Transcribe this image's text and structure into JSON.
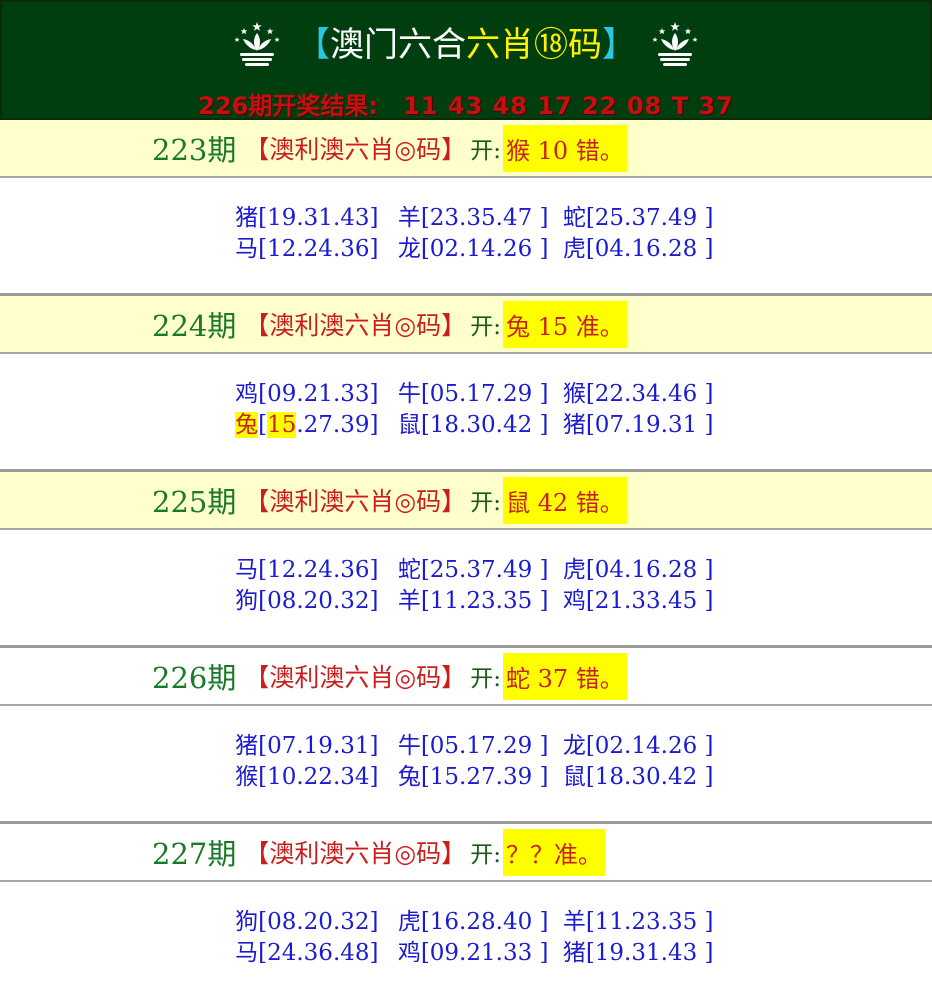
{
  "header": {
    "bracket_left": "【",
    "title_part1": "澳门六合",
    "title_part2": "六肖⑱码",
    "bracket_right": "】",
    "result_label": "226期开奖结果:",
    "result_numbers": "11 43 48 17 22 08 T 37"
  },
  "colors": {
    "header_bg": "#003e10",
    "title_bracket": "#26c9e0",
    "title_highlight": "#fff200",
    "result_red": "#c41010",
    "issue_green": "#1a7a2a",
    "label_red": "#c81e1e",
    "zodiac_blue": "#1b1bd0",
    "answer_bg": "#ffff00",
    "cream_bg": "#ffffcc"
  },
  "periods": [
    {
      "issue": "223期",
      "label": "【澳利澳六肖◎码】",
      "open_label": "开:",
      "answer": "猴 10 错。",
      "rows": [
        [
          "猪[19.31.43]",
          "羊[23.35.47 ]",
          "蛇[25.37.49 ]"
        ],
        [
          "马[12.24.36]",
          "龙[02.14.26 ]",
          "虎[04.16.28 ]"
        ]
      ]
    },
    {
      "issue": "224期",
      "label": "【澳利澳六肖◎码】",
      "open_label": "开:",
      "answer": "兔 15 准。",
      "rows": [
        [
          "鸡[09.21.33]",
          "牛[05.17.29 ]",
          "猴[22.34.46 ]"
        ],
        [
          "兔[15.27.39]",
          "鼠[18.30.42 ]",
          "猪[07.19.31 ]"
        ]
      ],
      "hit": {
        "zodiac": "兔",
        "open": "[",
        "number": "15",
        "rest": ".27.39]"
      }
    },
    {
      "issue": "225期",
      "label": "【澳利澳六肖◎码】",
      "open_label": "开:",
      "answer": "鼠 42 错。",
      "rows": [
        [
          "马[12.24.36]",
          "蛇[25.37.49 ]",
          "虎[04.16.28 ]"
        ],
        [
          "狗[08.20.32]",
          "羊[11.23.35 ]",
          "鸡[21.33.45 ]"
        ]
      ]
    },
    {
      "issue": "226期",
      "label": "【澳利澳六肖◎码】",
      "open_label": "开:",
      "answer": "蛇 37 错。",
      "rows": [
        [
          "猪[07.19.31]",
          "牛[05.17.29 ]",
          "龙[02.14.26 ]"
        ],
        [
          "猴[10.22.34]",
          "兔[15.27.39 ]",
          "鼠[18.30.42 ]"
        ]
      ]
    },
    {
      "issue": "227期",
      "label": "【澳利澳六肖◎码】",
      "open_label": "开:",
      "answer": " ？？准。",
      "rows": [
        [
          "狗[08.20.32]",
          "虎[16.28.40 ]",
          "羊[11.23.35 ]"
        ],
        [
          "马[24.36.48]",
          "鸡[09.21.33 ]",
          "猪[19.31.43 ]"
        ]
      ]
    }
  ]
}
